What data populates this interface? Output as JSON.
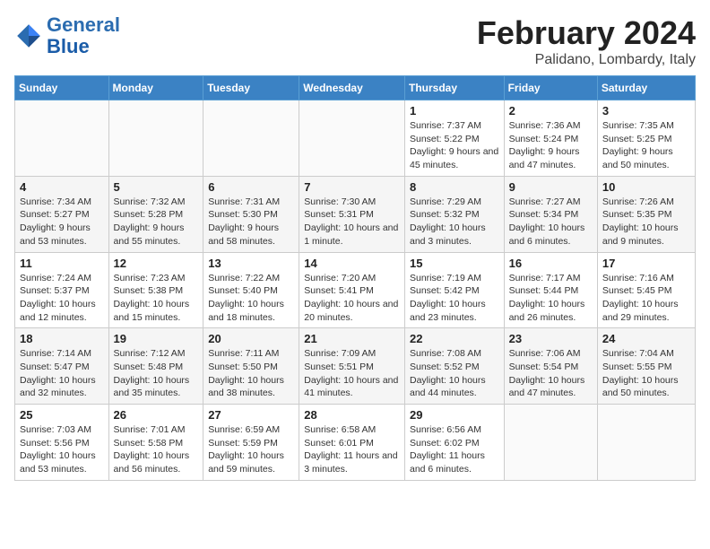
{
  "logo": {
    "name_general": "General",
    "name_blue": "Blue"
  },
  "title": "February 2024",
  "subtitle": "Palidano, Lombardy, Italy",
  "header_days": [
    "Sunday",
    "Monday",
    "Tuesday",
    "Wednesday",
    "Thursday",
    "Friday",
    "Saturday"
  ],
  "weeks": [
    [
      {
        "day": "",
        "info": ""
      },
      {
        "day": "",
        "info": ""
      },
      {
        "day": "",
        "info": ""
      },
      {
        "day": "",
        "info": ""
      },
      {
        "day": "1",
        "info": "Sunrise: 7:37 AM\nSunset: 5:22 PM\nDaylight: 9 hours and 45 minutes."
      },
      {
        "day": "2",
        "info": "Sunrise: 7:36 AM\nSunset: 5:24 PM\nDaylight: 9 hours and 47 minutes."
      },
      {
        "day": "3",
        "info": "Sunrise: 7:35 AM\nSunset: 5:25 PM\nDaylight: 9 hours and 50 minutes."
      }
    ],
    [
      {
        "day": "4",
        "info": "Sunrise: 7:34 AM\nSunset: 5:27 PM\nDaylight: 9 hours and 53 minutes."
      },
      {
        "day": "5",
        "info": "Sunrise: 7:32 AM\nSunset: 5:28 PM\nDaylight: 9 hours and 55 minutes."
      },
      {
        "day": "6",
        "info": "Sunrise: 7:31 AM\nSunset: 5:30 PM\nDaylight: 9 hours and 58 minutes."
      },
      {
        "day": "7",
        "info": "Sunrise: 7:30 AM\nSunset: 5:31 PM\nDaylight: 10 hours and 1 minute."
      },
      {
        "day": "8",
        "info": "Sunrise: 7:29 AM\nSunset: 5:32 PM\nDaylight: 10 hours and 3 minutes."
      },
      {
        "day": "9",
        "info": "Sunrise: 7:27 AM\nSunset: 5:34 PM\nDaylight: 10 hours and 6 minutes."
      },
      {
        "day": "10",
        "info": "Sunrise: 7:26 AM\nSunset: 5:35 PM\nDaylight: 10 hours and 9 minutes."
      }
    ],
    [
      {
        "day": "11",
        "info": "Sunrise: 7:24 AM\nSunset: 5:37 PM\nDaylight: 10 hours and 12 minutes."
      },
      {
        "day": "12",
        "info": "Sunrise: 7:23 AM\nSunset: 5:38 PM\nDaylight: 10 hours and 15 minutes."
      },
      {
        "day": "13",
        "info": "Sunrise: 7:22 AM\nSunset: 5:40 PM\nDaylight: 10 hours and 18 minutes."
      },
      {
        "day": "14",
        "info": "Sunrise: 7:20 AM\nSunset: 5:41 PM\nDaylight: 10 hours and 20 minutes."
      },
      {
        "day": "15",
        "info": "Sunrise: 7:19 AM\nSunset: 5:42 PM\nDaylight: 10 hours and 23 minutes."
      },
      {
        "day": "16",
        "info": "Sunrise: 7:17 AM\nSunset: 5:44 PM\nDaylight: 10 hours and 26 minutes."
      },
      {
        "day": "17",
        "info": "Sunrise: 7:16 AM\nSunset: 5:45 PM\nDaylight: 10 hours and 29 minutes."
      }
    ],
    [
      {
        "day": "18",
        "info": "Sunrise: 7:14 AM\nSunset: 5:47 PM\nDaylight: 10 hours and 32 minutes."
      },
      {
        "day": "19",
        "info": "Sunrise: 7:12 AM\nSunset: 5:48 PM\nDaylight: 10 hours and 35 minutes."
      },
      {
        "day": "20",
        "info": "Sunrise: 7:11 AM\nSunset: 5:50 PM\nDaylight: 10 hours and 38 minutes."
      },
      {
        "day": "21",
        "info": "Sunrise: 7:09 AM\nSunset: 5:51 PM\nDaylight: 10 hours and 41 minutes."
      },
      {
        "day": "22",
        "info": "Sunrise: 7:08 AM\nSunset: 5:52 PM\nDaylight: 10 hours and 44 minutes."
      },
      {
        "day": "23",
        "info": "Sunrise: 7:06 AM\nSunset: 5:54 PM\nDaylight: 10 hours and 47 minutes."
      },
      {
        "day": "24",
        "info": "Sunrise: 7:04 AM\nSunset: 5:55 PM\nDaylight: 10 hours and 50 minutes."
      }
    ],
    [
      {
        "day": "25",
        "info": "Sunrise: 7:03 AM\nSunset: 5:56 PM\nDaylight: 10 hours and 53 minutes."
      },
      {
        "day": "26",
        "info": "Sunrise: 7:01 AM\nSunset: 5:58 PM\nDaylight: 10 hours and 56 minutes."
      },
      {
        "day": "27",
        "info": "Sunrise: 6:59 AM\nSunset: 5:59 PM\nDaylight: 10 hours and 59 minutes."
      },
      {
        "day": "28",
        "info": "Sunrise: 6:58 AM\nSunset: 6:01 PM\nDaylight: 11 hours and 3 minutes."
      },
      {
        "day": "29",
        "info": "Sunrise: 6:56 AM\nSunset: 6:02 PM\nDaylight: 11 hours and 6 minutes."
      },
      {
        "day": "",
        "info": ""
      },
      {
        "day": "",
        "info": ""
      }
    ]
  ]
}
